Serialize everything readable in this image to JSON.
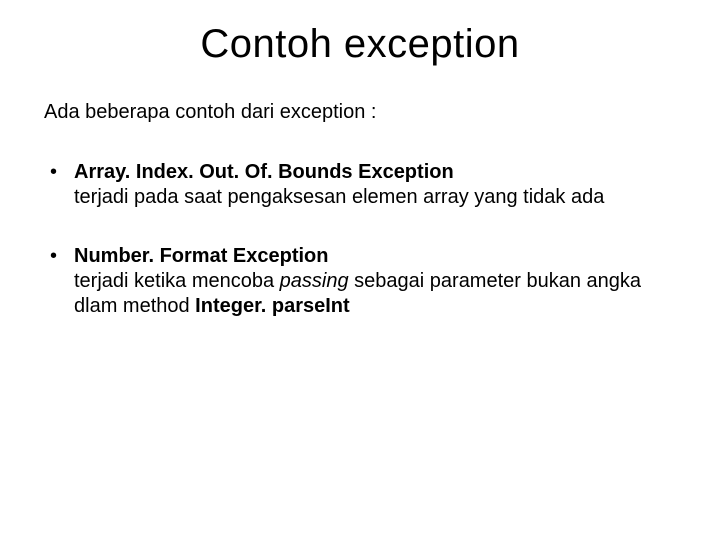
{
  "title": "Contoh exception",
  "intro": "Ada beberapa contoh dari exception :",
  "items": [
    {
      "heading": "Array. Index. Out. Of. Bounds Exception",
      "body_pre": "terjadi pada saat pengaksesan elemen array yang tidak ada"
    },
    {
      "heading": "Number. Format Exception",
      "body_pre": "terjadi ketika mencoba ",
      "body_em": "passing",
      "body_mid": " sebagai parameter bukan angka dlam method ",
      "body_bold": "Integer. parseInt"
    }
  ]
}
